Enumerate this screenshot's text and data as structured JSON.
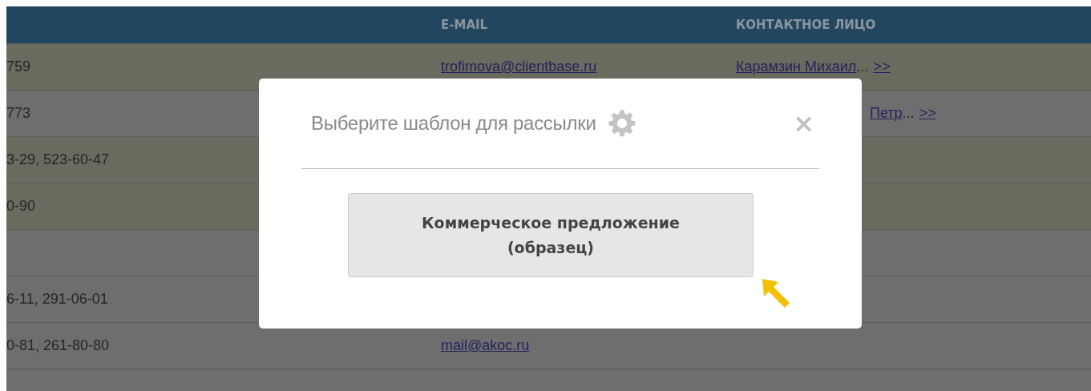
{
  "table": {
    "columns": [
      "",
      "E-MAIL",
      "КОНТАКТНОЕ ЛИЦО"
    ],
    "rows": [
      {
        "highlighted": true,
        "phone": "759",
        "email": "trofimova@clientbase.ru",
        "contact": "Карамзин Михаил",
        "ellipsis": "...",
        "more": ">>",
        "kind": "full"
      },
      {
        "highlighted": false,
        "phone": "773",
        "contact": "Петр",
        "ellipsis": "...",
        "more": ">>",
        "kind": "covered"
      },
      {
        "highlighted": true,
        "phone": "3-29, 523-60-47"
      },
      {
        "highlighted": true,
        "phone": "0-90"
      },
      {
        "highlighted": false
      },
      {
        "highlighted": false,
        "phone": "6-11, 291-06-01"
      },
      {
        "highlighted": false,
        "phone": "0-81, 261-80-80",
        "email": "mail@akoc.ru"
      },
      {
        "highlighted": false
      }
    ]
  },
  "dialog": {
    "title": "Выберите шаблон для рассылки",
    "close": "×",
    "templates": [
      "Коммерческое предложение (образец)"
    ]
  }
}
